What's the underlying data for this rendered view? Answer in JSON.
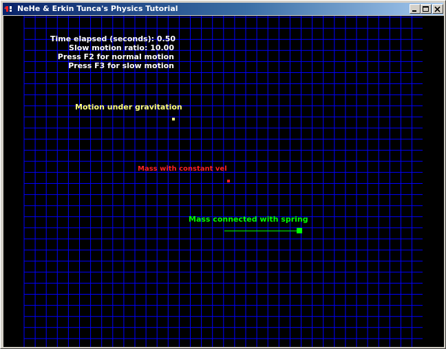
{
  "window": {
    "title": "NeHe & Erkin Tunca's Physics Tutorial",
    "controls": [
      "minimize",
      "maximize",
      "close"
    ]
  },
  "hud": {
    "time_elapsed": "Time elapsed (seconds): 0.50",
    "slow_motion_ratio": "Slow motion ratio: 10.00",
    "hint_f2": "Press F2 for normal motion",
    "hint_f3": "Press F3 for slow motion"
  },
  "simulations": {
    "gravity_label": "Motion under gravitation",
    "constant_velocity_label": "Mass with constant vel",
    "spring_label": "Mass connected with spring"
  },
  "colors": {
    "background": "#000000",
    "grid_line": "#0000ff",
    "hud_text": "#ffffff",
    "gravity": "#ffff80",
    "constant_velocity": "#ff2020",
    "spring": "#00ff00"
  },
  "icons": {
    "app": "nehe-app-icon",
    "minimize": "minimize-icon",
    "maximize": "maximize-icon",
    "close": "close-icon"
  }
}
